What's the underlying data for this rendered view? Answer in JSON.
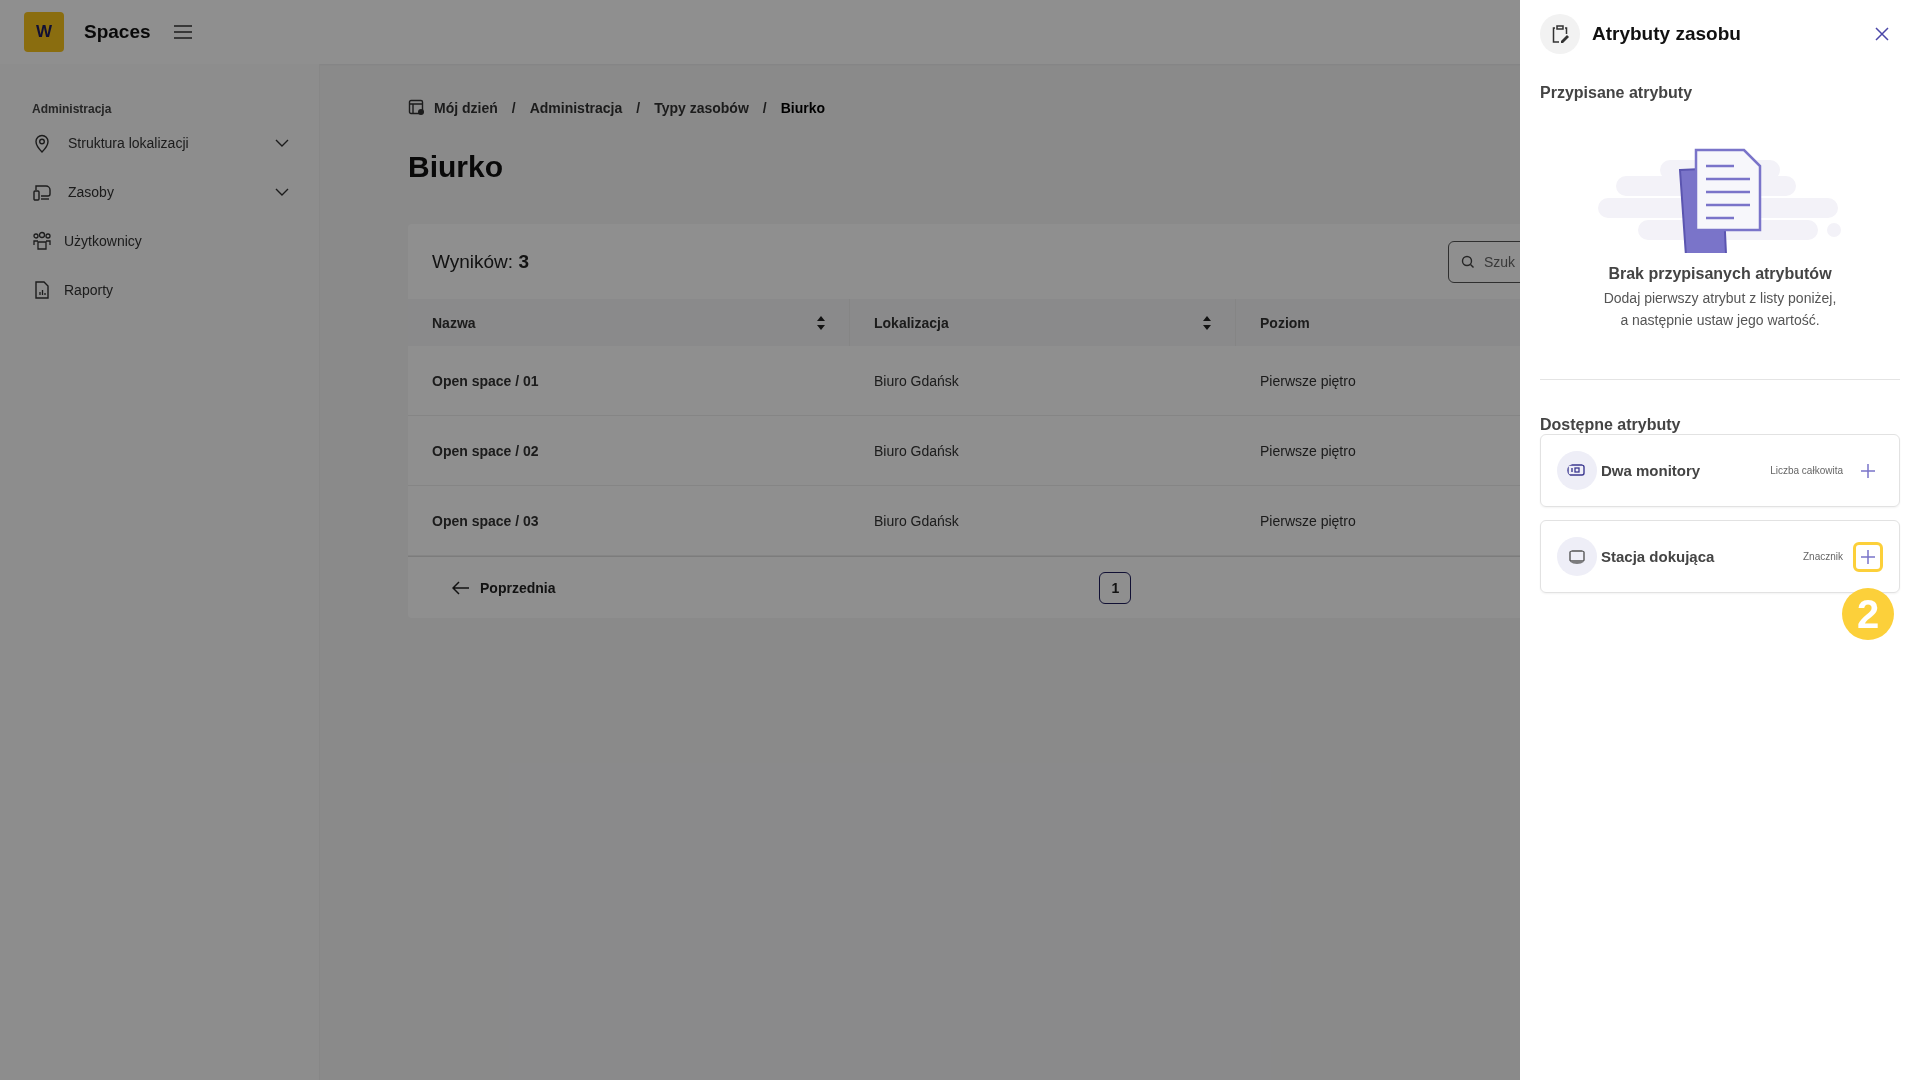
{
  "app": {
    "logo": "W",
    "title": "Spaces"
  },
  "sidebar": {
    "section": "Administracja",
    "items": [
      {
        "label": "Struktura lokalizacji",
        "expandable": true
      },
      {
        "label": "Zasoby",
        "expandable": true
      },
      {
        "label": "Użytkownicy",
        "expandable": false
      },
      {
        "label": "Raporty",
        "expandable": false
      }
    ]
  },
  "breadcrumb": [
    {
      "label": "Mój dzień",
      "current": false
    },
    {
      "separator": "/",
      "label": "Administracja",
      "current": false
    },
    {
      "separator": "/",
      "label": "Typy zasobów",
      "current": false
    },
    {
      "separator": "/",
      "label": "Biurko",
      "current": true
    }
  ],
  "page_title": "Biurko",
  "table": {
    "results_label": "Wyników:",
    "results_count": "3",
    "search_placeholder": "Szuk",
    "columns": [
      {
        "label": "Nazwa",
        "sortable": true
      },
      {
        "label": "Lokalizacja",
        "sortable": true
      },
      {
        "label": "Poziom",
        "sortable": false
      }
    ],
    "rows": [
      [
        "Open space / 01",
        "Biuro Gdańsk",
        "Pierwsze piętro"
      ],
      [
        "Open space / 02",
        "Biuro Gdańsk",
        "Pierwsze piętro"
      ],
      [
        "Open space / 03",
        "Biuro Gdańsk",
        "Pierwsze piętro"
      ]
    ],
    "pagination": {
      "previous": "Poprzednia",
      "pages": [
        {
          "label": "1",
          "selected": true
        }
      ]
    }
  },
  "panel": {
    "title": "Atrybuty zasobu",
    "assigned": {
      "heading": "Przypisane atrybuty",
      "empty_title": "Brak przypisanych atrybutów",
      "empty_text": "Dodaj pierwszy atrybut z listy poniżej,\na następnie ustaw jego wartość."
    },
    "available": {
      "heading": "Dostępne atrybuty",
      "items": [
        {
          "name": "Dwa monitory",
          "type": "Liczba całkowita",
          "highlighted": false
        },
        {
          "name": "Stacja dokująca",
          "type": "Znacznik",
          "highlighted": true
        }
      ]
    }
  },
  "annotation": {
    "step": "2"
  }
}
